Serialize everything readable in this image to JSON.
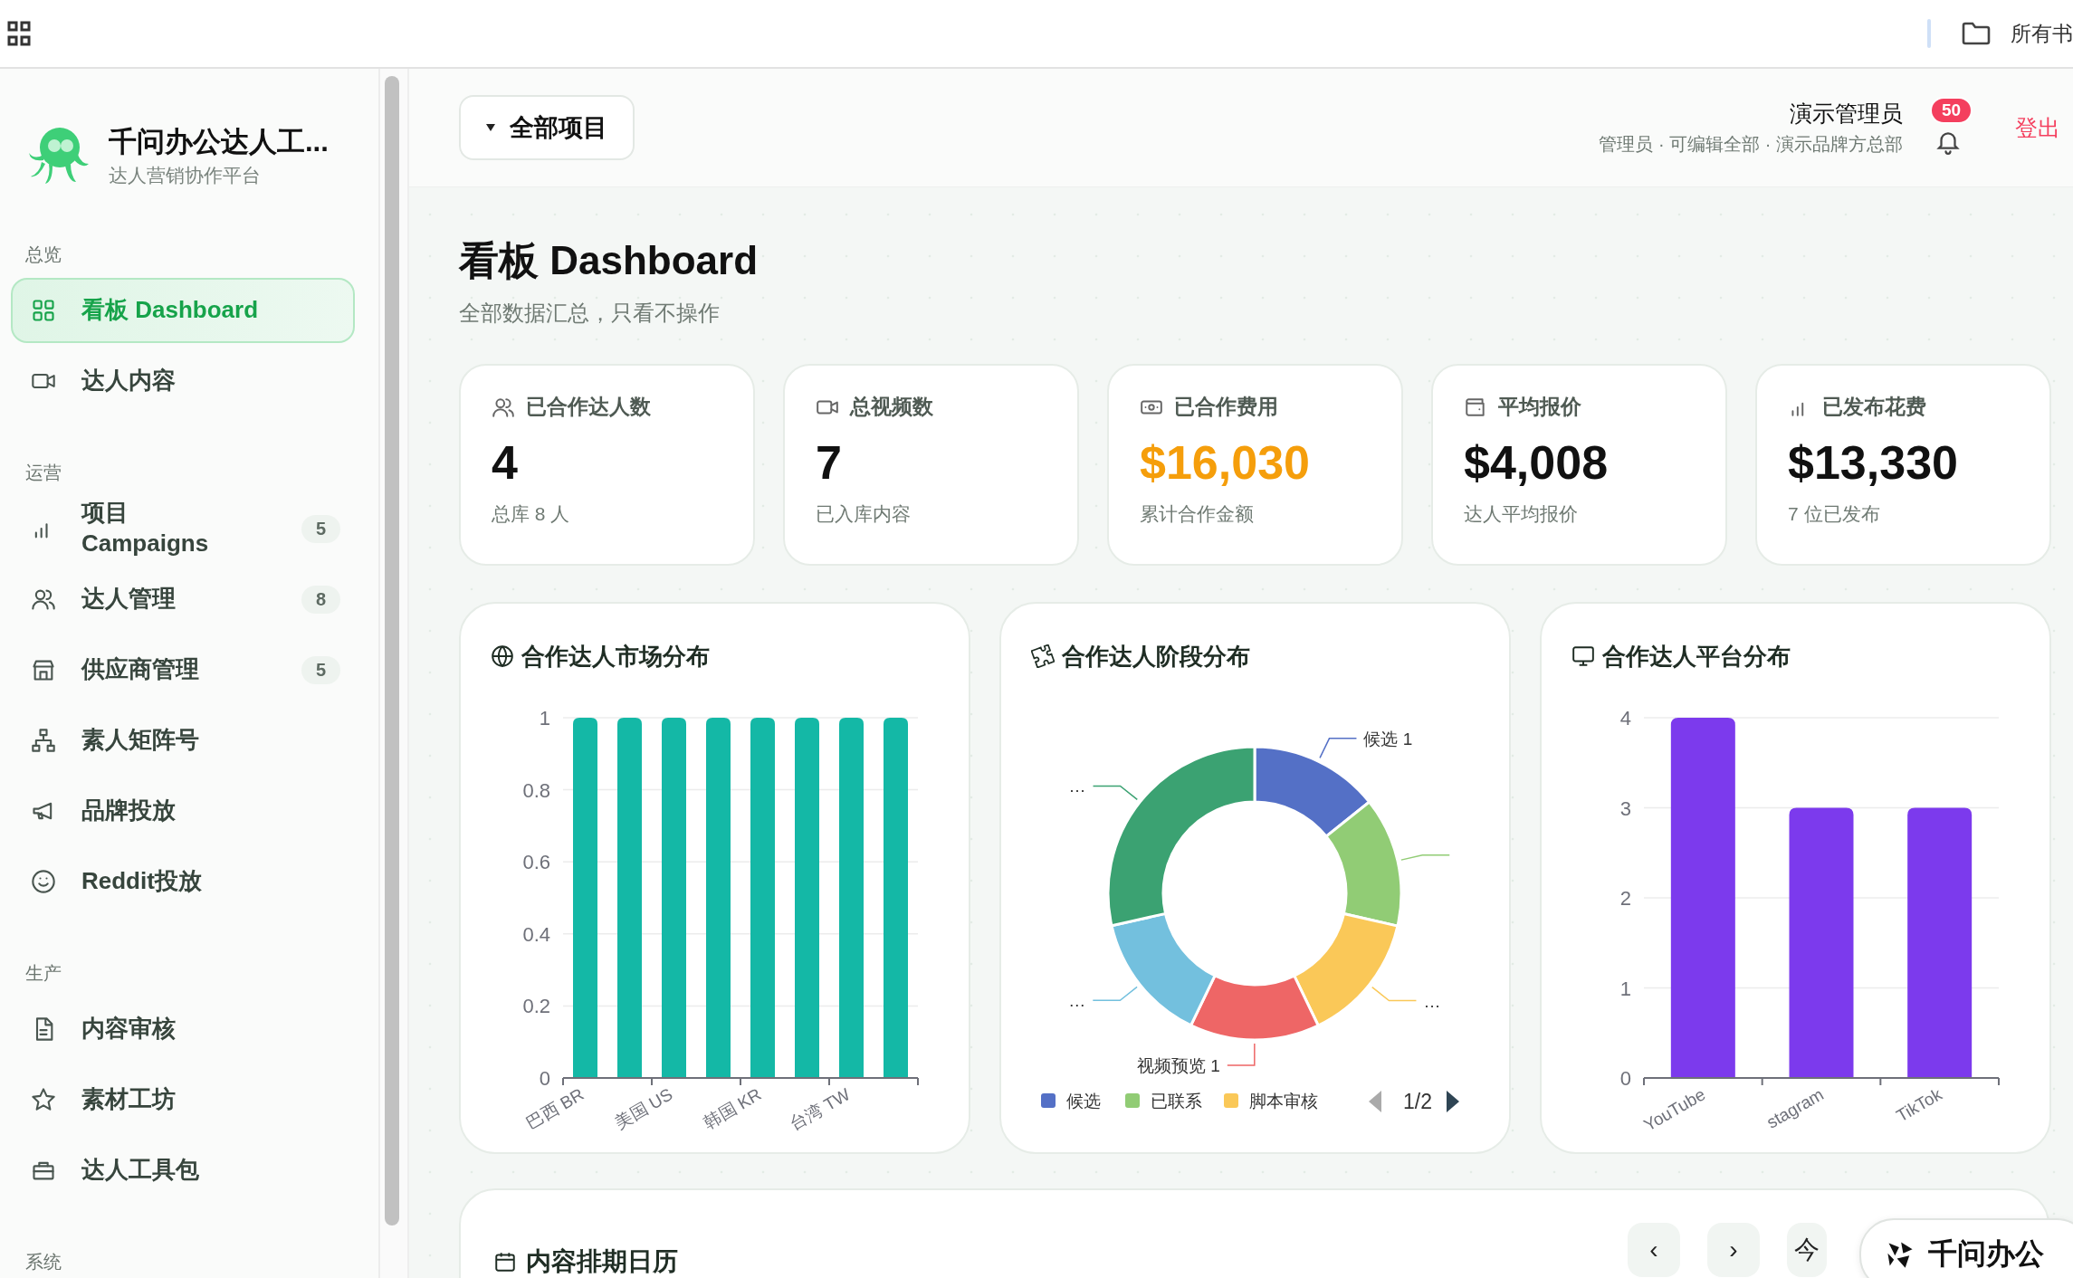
{
  "top_bar": {
    "shortcut": "所有书"
  },
  "sidebar": {
    "app_title": "千问办公达人工...",
    "app_subtitle": "达人营销协作平台",
    "sections": [
      {
        "title": "总览",
        "items": [
          {
            "label": "看板 Dashboard",
            "selected": true
          },
          {
            "label": "达人内容",
            "selected": false
          }
        ]
      },
      {
        "title": "运营",
        "items": [
          {
            "label": "项目 Campaigns",
            "badge": "5",
            "selected": false
          },
          {
            "label": "达人管理",
            "badge": "8",
            "selected": false
          },
          {
            "label": "供应商管理",
            "badge": "5",
            "selected": false
          },
          {
            "label": "素人矩阵号",
            "selected": false
          },
          {
            "label": "品牌投放",
            "selected": false
          },
          {
            "label": "Reddit投放",
            "selected": false
          }
        ]
      },
      {
        "title": "生产",
        "items": [
          {
            "label": "内容审核",
            "selected": false
          },
          {
            "label": "素材工坊",
            "selected": false
          },
          {
            "label": "达人工具包",
            "selected": false
          }
        ]
      },
      {
        "title": "系统"
      }
    ]
  },
  "header": {
    "project_filter": "全部项目",
    "user_name": "演示管理员",
    "user_role": "管理员 · 可编辑全部 · 演示品牌方总部",
    "notifications": "50",
    "logout": "登出"
  },
  "page": {
    "title": "看板 Dashboard",
    "subtitle": "全部数据汇总，只看不操作"
  },
  "stats": [
    {
      "label": "已合作达人数",
      "value": "4",
      "note": "总库 8 人",
      "highlight": false
    },
    {
      "label": "总视频数",
      "value": "7",
      "note": "已入库内容",
      "highlight": false
    },
    {
      "label": "已合作费用",
      "value": "$16,030",
      "note": "累计合作金额",
      "highlight": true
    },
    {
      "label": "平均报价",
      "value": "$4,008",
      "note": "达人平均报价",
      "highlight": false
    },
    {
      "label": "已发布花费",
      "value": "$13,330",
      "note": "7 位已发布",
      "highlight": false
    }
  ],
  "market_card": {
    "title": "合作达人市场分布",
    "chart_data": {
      "type": "bar",
      "series": [
        {
          "color": "#14b8a6",
          "values": [
            1,
            1,
            1,
            1,
            1,
            1,
            1,
            1
          ]
        }
      ],
      "ylim": [
        0,
        1
      ],
      "yticks": [
        0,
        0.2,
        0.4,
        0.6,
        0.8,
        1
      ],
      "grid": true,
      "categories": [
        "巴西 BR",
        null,
        "美国 US",
        null,
        "韩国 KR",
        null,
        "台湾 TW",
        null
      ]
    }
  },
  "stage_card": {
    "title": "合作达人阶段分布",
    "chart_data": {
      "type": "donut",
      "values": [
        14.29,
        14.29,
        14.29,
        14.29,
        14.29,
        28.55
      ]
    },
    "slices": [
      {
        "color": "#5470c6",
        "label": "候选 1"
      },
      {
        "color": "#91cc75"
      },
      {
        "color": "#fac858",
        "label": "…"
      },
      {
        "color": "#ee6666",
        "label": "视频预览 1"
      },
      {
        "color": "#73c0de",
        "label": "…"
      },
      {
        "color": "#3ba272",
        "label": "…"
      }
    ],
    "legend": [
      {
        "label": "候选",
        "color": "#5470c6"
      },
      {
        "label": "已联系",
        "color": "#91cc75"
      },
      {
        "label": "脚本审核",
        "color": "#fac858"
      }
    ],
    "pager": {
      "page": "1/2",
      "prev_disabled": true,
      "next_disabled": false
    }
  },
  "platform_card": {
    "title": "合作达人平台分布",
    "chart_data": {
      "type": "bar",
      "categories": [
        "YouTube",
        "stagram",
        "TikTok"
      ],
      "series": [
        {
          "color": "#7c3aed",
          "values": [
            4,
            3,
            3
          ]
        }
      ],
      "ylim": [
        0,
        4
      ],
      "yticks": [
        0,
        1,
        2,
        3,
        4
      ],
      "grid": true
    }
  },
  "calendar": {
    "title": "内容排期日历",
    "prev": "‹",
    "next": "›",
    "today": "今"
  },
  "floating_badge": {
    "text": "千问办公"
  }
}
